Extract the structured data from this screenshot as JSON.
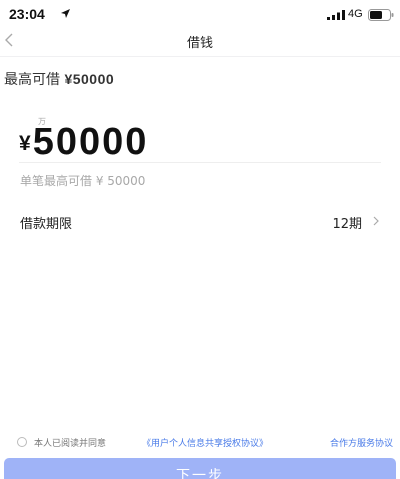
{
  "status_bar": {
    "time": "23:04",
    "network": "4G",
    "icons": [
      "location-icon",
      "signal-icon",
      "battery-icon"
    ]
  },
  "nav": {
    "title": "借钱",
    "back_icon": "chevron-left-icon"
  },
  "max_borrow": {
    "label": "最高可借",
    "amount": "¥50000"
  },
  "amount": {
    "unit_hint": "万",
    "currency": "¥",
    "value": "50000",
    "single_limit": "单笔最高可借 ¥ 50000"
  },
  "term": {
    "label": "借款期限",
    "value": "12期",
    "chevron_icon": "chevron-right-icon"
  },
  "agreement": {
    "text": "本人已阅读并同意",
    "link1": "《用户个人信息共享授权协议》",
    "link2": "合作方服务协议"
  },
  "next_button": {
    "label": "下一步"
  },
  "colors": {
    "accent": "#9fb3f7",
    "link": "#4a7be8",
    "muted_text": "#a8a8a8"
  }
}
